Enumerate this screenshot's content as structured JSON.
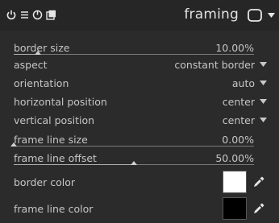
{
  "header": {
    "title": "framing",
    "icons": [
      "power-icon",
      "multi-instance-icon",
      "reset-icon",
      "presets-icon",
      "presets-menu-icon"
    ]
  },
  "sliders": {
    "border_size": {
      "label": "border size",
      "value": "10.00%",
      "fraction": 0.1
    },
    "frame_line_size": {
      "label": "frame line size",
      "value": "0.00%",
      "fraction": 0.0
    },
    "frame_line_offset": {
      "label": "frame line offset",
      "value": "50.00%",
      "fraction": 0.5
    }
  },
  "combos": {
    "aspect": {
      "label": "aspect",
      "value": "constant border"
    },
    "orientation": {
      "label": "orientation",
      "value": "auto"
    },
    "horizontal_position": {
      "label": "horizontal position",
      "value": "center"
    },
    "vertical_position": {
      "label": "vertical position",
      "value": "center"
    }
  },
  "colors": {
    "border_color": {
      "label": "border color",
      "swatch": "#ffffff",
      "picker_icon": "color-picker-icon"
    },
    "frame_line_color": {
      "label": "frame line color",
      "swatch": "#000000",
      "picker_icon": "color-picker-icon"
    }
  },
  "style": {
    "text": "#c6c6c6",
    "track": "#7a7a7a",
    "marker": "#cfcfcf"
  }
}
